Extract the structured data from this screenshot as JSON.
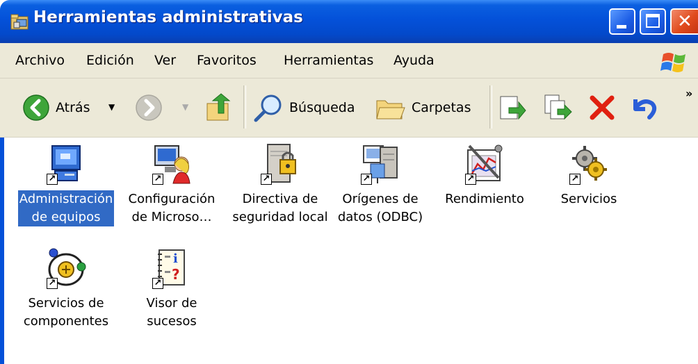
{
  "window": {
    "title": "Herramientas administrativas"
  },
  "menu": {
    "items": [
      "Archivo",
      "Edición",
      "Ver",
      "Favoritos",
      "Herramientas",
      "Ayuda"
    ]
  },
  "toolbar": {
    "back_label": "Atrás",
    "search_label": "Búsqueda",
    "folders_label": "Carpetas",
    "more_glyph": "»"
  },
  "items": [
    {
      "line1": "Administración",
      "line2": "de equipos",
      "icon": "computer-management-icon",
      "selected": true
    },
    {
      "line1": "Configuración",
      "line2": "de Microso…",
      "icon": "net-configuration-icon",
      "selected": false
    },
    {
      "line1": "Directiva de",
      "line2": "seguridad local",
      "icon": "local-security-policy-icon",
      "selected": false
    },
    {
      "line1": "Orígenes de",
      "line2": "datos (ODBC)",
      "icon": "odbc-data-sources-icon",
      "selected": false
    },
    {
      "line1": "Rendimiento",
      "line2": "",
      "icon": "performance-icon",
      "selected": false
    },
    {
      "line1": "Servicios",
      "line2": "",
      "icon": "services-icon",
      "selected": false
    },
    {
      "line1": "Servicios de",
      "line2": "componentes",
      "icon": "component-services-icon",
      "selected": false
    },
    {
      "line1": "Visor de",
      "line2": "sucesos",
      "icon": "event-viewer-icon",
      "selected": false
    }
  ],
  "colors": {
    "titlebar": "#0451d9",
    "selection": "#316ac5",
    "chrome": "#ece9d8"
  }
}
